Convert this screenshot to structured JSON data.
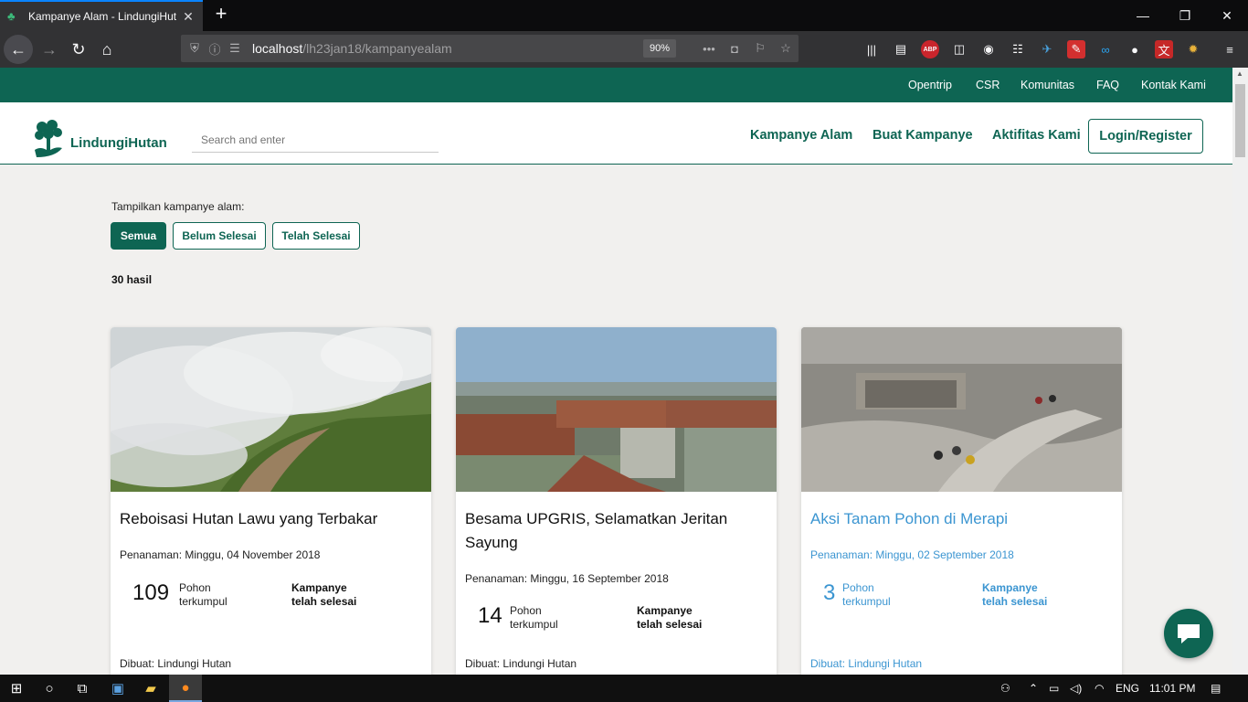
{
  "browser": {
    "tab_title": "Kampanye Alam - LindungiHut",
    "url_host": "localhost",
    "url_path": "/lh23jan18/kampanyealam",
    "zoom": "90%",
    "ext_abp": "ABP"
  },
  "topbar": {
    "links": [
      "Opentrip",
      "CSR",
      "Komunitas",
      "FAQ",
      "Kontak Kami"
    ]
  },
  "header": {
    "brand": "LindungiHutan",
    "search_placeholder": "Search and enter",
    "nav": [
      "Kampanye Alam",
      "Buat Kampanye",
      "Aktifitas Kami"
    ],
    "login": "Login/Register"
  },
  "filter": {
    "label": "Tampilkan kampanye alam:",
    "buttons": [
      "Semua",
      "Belum Selesai",
      "Telah Selesai"
    ],
    "active": "Semua",
    "results": "30 hasil"
  },
  "cards": [
    {
      "title": "Reboisasi Hutan Lawu yang Terbakar",
      "planting": "Penanaman: Minggu, 04 November 2018",
      "count": "109",
      "count_label_1": "Pohon",
      "count_label_2": "terkumpul",
      "status_1": "Kampanye",
      "status_2": "telah selesai",
      "creator": "Dibuat: Lindungi Hutan"
    },
    {
      "title": "Besama UPGRIS, Selamatkan Jeritan Sayung",
      "planting": "Penanaman: Minggu, 16 September 2018",
      "count": "14",
      "count_label_1": "Pohon",
      "count_label_2": "terkumpul",
      "status_1": "Kampanye",
      "status_2": "telah selesai",
      "creator": "Dibuat: Lindungi Hutan"
    },
    {
      "title": "Aksi Tanam Pohon di Merapi",
      "planting": "Penanaman: Minggu, 02 September 2018",
      "count": "3",
      "count_label_1": "Pohon",
      "count_label_2": "terkumpul",
      "status_1": "Kampanye",
      "status_2": "telah selesai",
      "creator": "Dibuat: Lindungi Hutan"
    }
  ],
  "taskbar": {
    "lang": "ENG",
    "time": "11:01 PM"
  },
  "colors": {
    "brand_green": "#0e6553",
    "link_blue": "#3b95d1"
  }
}
